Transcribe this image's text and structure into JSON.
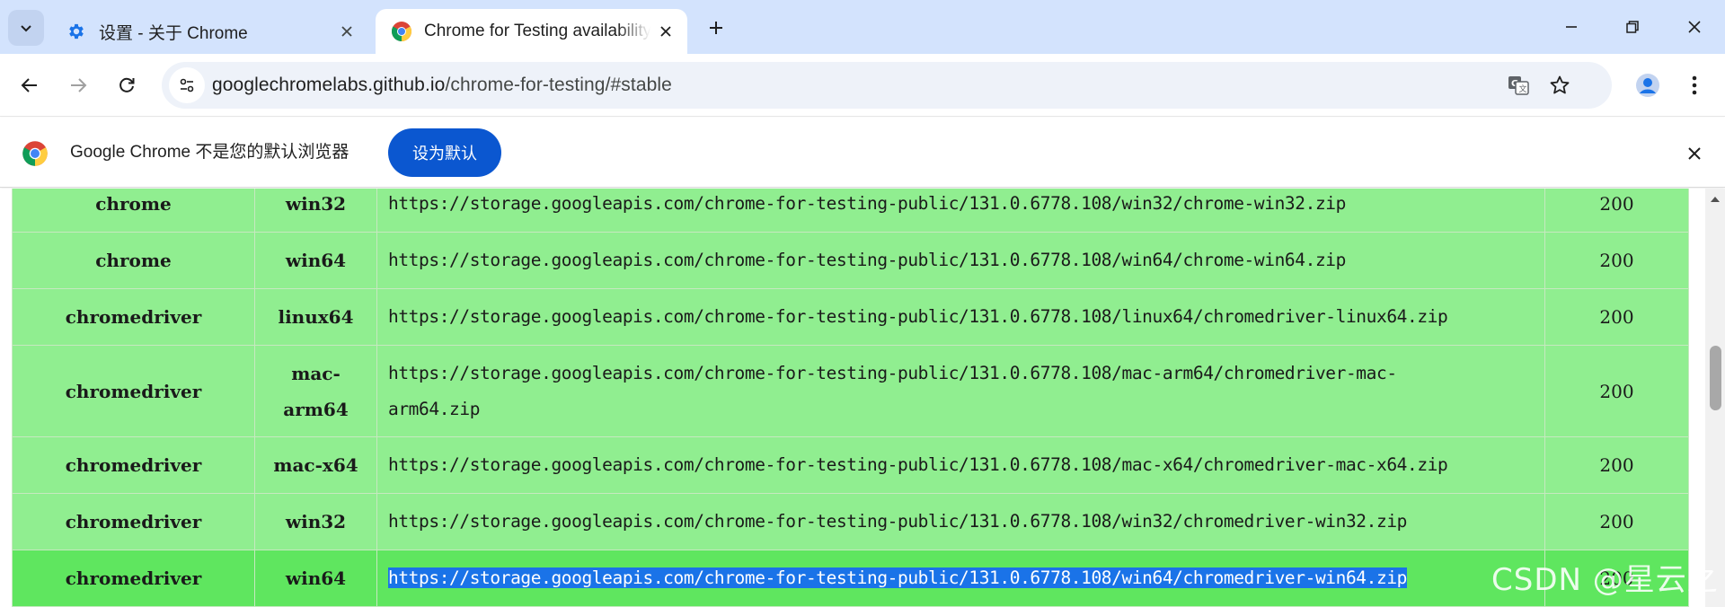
{
  "window": {
    "tabs": [
      {
        "title": "设置 - 关于 Chrome",
        "icon": "gear-icon",
        "active": false
      },
      {
        "title": "Chrome for Testing availability",
        "icon": "chrome-logo-icon",
        "active": true
      }
    ]
  },
  "toolbar": {
    "url_host": "googlechromelabs.github.io",
    "url_path": "/chrome-for-testing/#stable"
  },
  "infobar": {
    "message": "Google Chrome 不是您的默认浏览器",
    "button_label": "设为默认"
  },
  "downloads": {
    "rows": [
      {
        "binary": "chrome",
        "platform": "win32",
        "url": "https://storage.googleapis.com/chrome-for-testing-public/131.0.6778.108/win32/chrome-win32.zip",
        "status": "200"
      },
      {
        "binary": "chrome",
        "platform": "win64",
        "url": "https://storage.googleapis.com/chrome-for-testing-public/131.0.6778.108/win64/chrome-win64.zip",
        "status": "200"
      },
      {
        "binary": "chromedriver",
        "platform": "linux64",
        "url": "https://storage.googleapis.com/chrome-for-testing-public/131.0.6778.108/linux64/chromedriver-linux64.zip",
        "status": "200"
      },
      {
        "binary": "chromedriver",
        "platform_line1": "mac-",
        "platform_line2": "arm64",
        "url_line1": "https://storage.googleapis.com/chrome-for-testing-public/131.0.6778.108/mac-arm64/chromedriver-mac-",
        "url_line2": "arm64.zip",
        "status": "200"
      },
      {
        "binary": "chromedriver",
        "platform": "mac-x64",
        "url": "https://storage.googleapis.com/chrome-for-testing-public/131.0.6778.108/mac-x64/chromedriver-mac-x64.zip",
        "status": "200"
      },
      {
        "binary": "chromedriver",
        "platform": "win32",
        "url": "https://storage.googleapis.com/chrome-for-testing-public/131.0.6778.108/win32/chromedriver-win32.zip",
        "status": "200"
      },
      {
        "binary": "chromedriver",
        "platform": "win64",
        "url": "https://storage.googleapis.com/chrome-for-testing-public/131.0.6778.108/win64/chromedriver-win64.zip",
        "status": "200",
        "selected": true
      }
    ]
  },
  "watermark": "CSDN @星云之",
  "colors": {
    "tabstrip_bg": "#d3e3fd",
    "row_bg": "#90ee90",
    "row_highlight_bg": "#5fe65f",
    "selection": "#1a73e8",
    "primary_button": "#0b57d0"
  }
}
